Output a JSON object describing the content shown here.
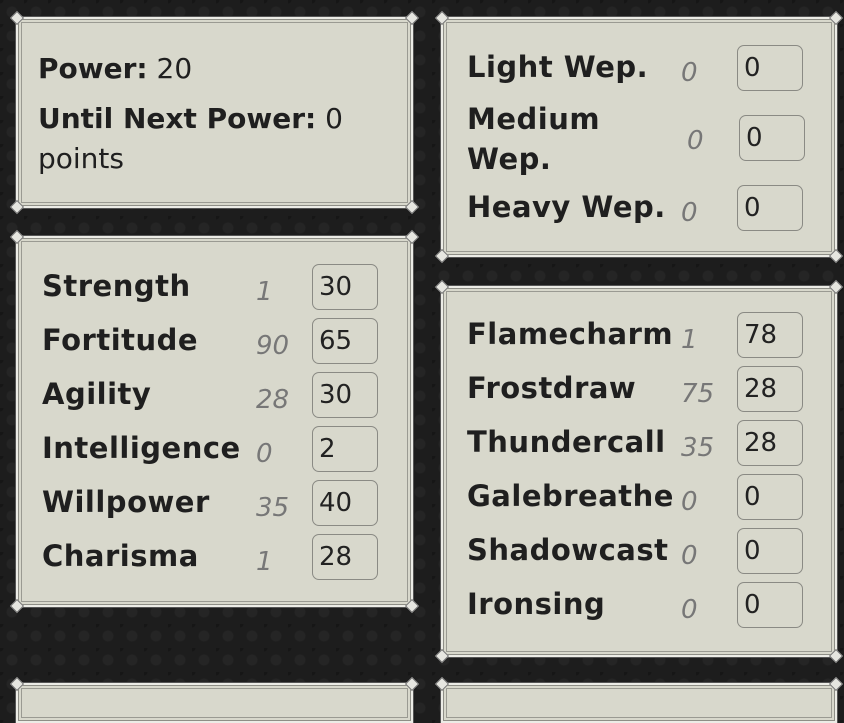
{
  "power_panel": {
    "power_label": "Power:",
    "power_value": "20",
    "next_label": "Until Next Power:",
    "next_value": "0",
    "next_unit": "points"
  },
  "weapons": [
    {
      "name": "Light Wep.",
      "level": "0",
      "value": "0"
    },
    {
      "name_line1": "Medium",
      "name_line2": "Wep.",
      "level": "0",
      "value": "0"
    },
    {
      "name": "Heavy Wep.",
      "level": "0",
      "value": "0"
    }
  ],
  "stats": [
    {
      "name": "Strength",
      "level": "1",
      "value": "30"
    },
    {
      "name": "Fortitude",
      "level": "90",
      "value": "65"
    },
    {
      "name": "Agility",
      "level": "28",
      "value": "30"
    },
    {
      "name": "Intelligence",
      "level": "0",
      "value": "2"
    },
    {
      "name": "Willpower",
      "level": "35",
      "value": "40"
    },
    {
      "name": "Charisma",
      "level": "1",
      "value": "28"
    }
  ],
  "magic": [
    {
      "name": "Flamecharm",
      "level": "1",
      "value": "78"
    },
    {
      "name": "Frostdraw",
      "level": "75",
      "value": "28"
    },
    {
      "name": "Thundercall",
      "level": "35",
      "value": "28"
    },
    {
      "name": "Galebreathe",
      "level": "0",
      "value": "0"
    },
    {
      "name": "Shadowcast",
      "level": "0",
      "value": "0"
    },
    {
      "name": "Ironsing",
      "level": "0",
      "value": "0"
    }
  ]
}
